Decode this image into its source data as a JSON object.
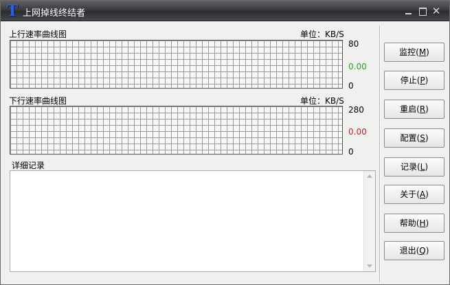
{
  "window": {
    "title": "上网掉线终结者",
    "logo_glyph": "T",
    "close_glyph": "✕"
  },
  "upload": {
    "label": "上行速率曲线图",
    "unit": "单位：KB/S",
    "max": "80",
    "current": "0.00",
    "min": "0"
  },
  "download": {
    "label": "下行速率曲线图",
    "unit": "单位：KB/S",
    "max": "280",
    "current": "0.00",
    "min": "0"
  },
  "log": {
    "label": "详细记录",
    "content": ""
  },
  "buttons": [
    {
      "text": "监控(",
      "key": "M",
      "end": ")"
    },
    {
      "text": "停止(",
      "key": "P",
      "end": ")"
    },
    {
      "text": "重启(",
      "key": "R",
      "end": ")"
    },
    {
      "text": "配置(",
      "key": "S",
      "end": ")"
    },
    {
      "text": "记录(",
      "key": "L",
      "end": ")"
    },
    {
      "text": "关于(",
      "key": "A",
      "end": ")"
    },
    {
      "text": "帮助(",
      "key": "H",
      "end": ")"
    },
    {
      "text": "退出(",
      "key": "Q",
      "end": ")"
    }
  ],
  "colors": {
    "rate_up": "#2aa02a",
    "rate_down": "#b02a2a",
    "logo": "#2f5fd8"
  }
}
